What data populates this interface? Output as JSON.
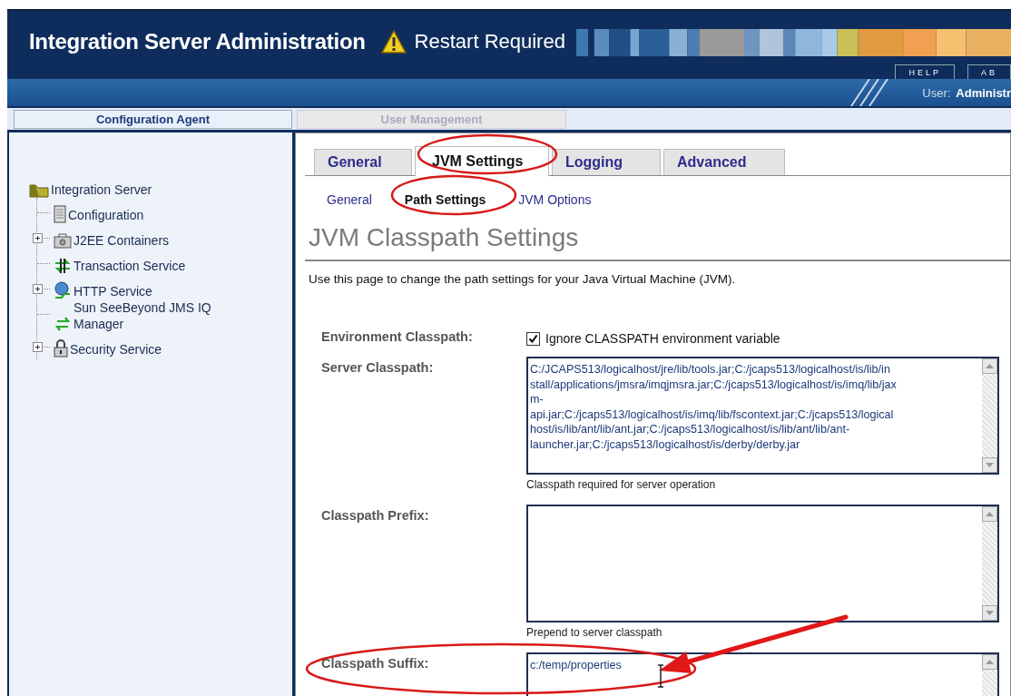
{
  "header": {
    "title": "Integration Server Administration",
    "alert": "Restart Required",
    "links": [
      "HELP",
      "AB"
    ],
    "user_label": "User:",
    "user_name": "Administr"
  },
  "frame_tabs": [
    {
      "label": "Configuration Agent",
      "selected": true
    },
    {
      "label": "User Management",
      "selected": false
    }
  ],
  "tree": {
    "label": "Integration Server",
    "kind": "server",
    "children": [
      {
        "label": "Configuration",
        "kind": "config",
        "collapsed": false
      },
      {
        "label": "J2EE Containers",
        "kind": "container",
        "collapsed": true
      },
      {
        "label": "Transaction Service",
        "kind": "transaction",
        "collapsed": false
      },
      {
        "label": "HTTP Service",
        "kind": "http",
        "collapsed": true
      },
      {
        "label": "Sun SeeBeyond JMS IQ Manager",
        "kind": "jms",
        "collapsed": false
      },
      {
        "label": "Security Service",
        "kind": "security",
        "collapsed": true
      }
    ]
  },
  "tabs": [
    {
      "label": "General",
      "selected": false
    },
    {
      "label": "JVM Settings",
      "selected": true
    },
    {
      "label": "Logging",
      "selected": false
    },
    {
      "label": "Advanced",
      "selected": false
    }
  ],
  "subtabs": [
    {
      "label": "General",
      "selected": false
    },
    {
      "label": "Path Settings",
      "selected": true
    },
    {
      "label": "JVM Options",
      "selected": false
    }
  ],
  "heading": "JVM Classpath Settings",
  "description": "Use this page to change the path settings for your Java Virtual Machine (JVM).",
  "fields": [
    {
      "label": "Environment Classpath:",
      "kind": "checkbox",
      "checked": true,
      "text": "Ignore CLASSPATH environment variable"
    },
    {
      "label": "Server Classpath:",
      "kind": "textarea",
      "lines": [
        "C:/JCAPS513/logicalhost/jre/lib/tools.jar;C:/jcaps513/logicalhost/is/lib/in",
        "stall/applications/jmsra/imqjmsra.jar;C:/jcaps513/logicalhost/is/imq/lib/jax",
        "m-",
        "api.jar;C:/jcaps513/logicalhost/is/imq/lib/fscontext.jar;C:/jcaps513/logical",
        "host/is/lib/ant/lib/ant.jar;C:/jcaps513/logicalhost/is/lib/ant/lib/ant-",
        "launcher.jar;C:/jcaps513/logicalhost/is/derby/derby.jar"
      ],
      "hint": "Classpath required for server operation"
    },
    {
      "label": "Classpath Prefix:",
      "kind": "textarea",
      "hint": "Prepend to server classpath"
    },
    {
      "label": "Classpath Suffix:",
      "kind": "textarea",
      "lines": [
        "c:/temp/properties"
      ]
    }
  ]
}
